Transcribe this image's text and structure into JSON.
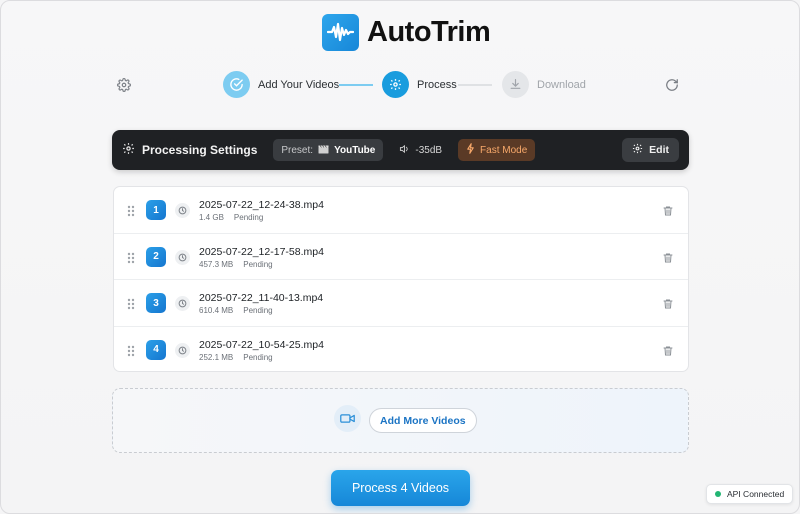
{
  "app": {
    "title": "AutoTrim"
  },
  "stepper": {
    "steps": [
      {
        "label": "Add Your Videos",
        "state": "done"
      },
      {
        "label": "Process",
        "state": "active"
      },
      {
        "label": "Download",
        "state": "pending"
      }
    ]
  },
  "settings": {
    "title": "Processing Settings",
    "preset_key": "Preset:",
    "preset_value": "YouTube",
    "volume": "-35dB",
    "fast_mode": "Fast Mode",
    "edit_label": "Edit"
  },
  "files": [
    {
      "index": "1",
      "name": "2025-07-22_12-24-38.mp4",
      "size": "1.4 GB",
      "status": "Pending"
    },
    {
      "index": "2",
      "name": "2025-07-22_12-17-58.mp4",
      "size": "457.3 MB",
      "status": "Pending"
    },
    {
      "index": "3",
      "name": "2025-07-22_11-40-13.mp4",
      "size": "610.4 MB",
      "status": "Pending"
    },
    {
      "index": "4",
      "name": "2025-07-22_10-54-25.mp4",
      "size": "252.1 MB",
      "status": "Pending"
    }
  ],
  "dropzone": {
    "add_more_label": "Add More Videos"
  },
  "process_button": {
    "label": "Process 4 Videos"
  },
  "api": {
    "status_label": "API Connected"
  },
  "colors": {
    "accent": "#199cde",
    "settings_bg": "#1f2124",
    "fast_mode": "#f7a86a",
    "status_ok": "#22b573"
  }
}
